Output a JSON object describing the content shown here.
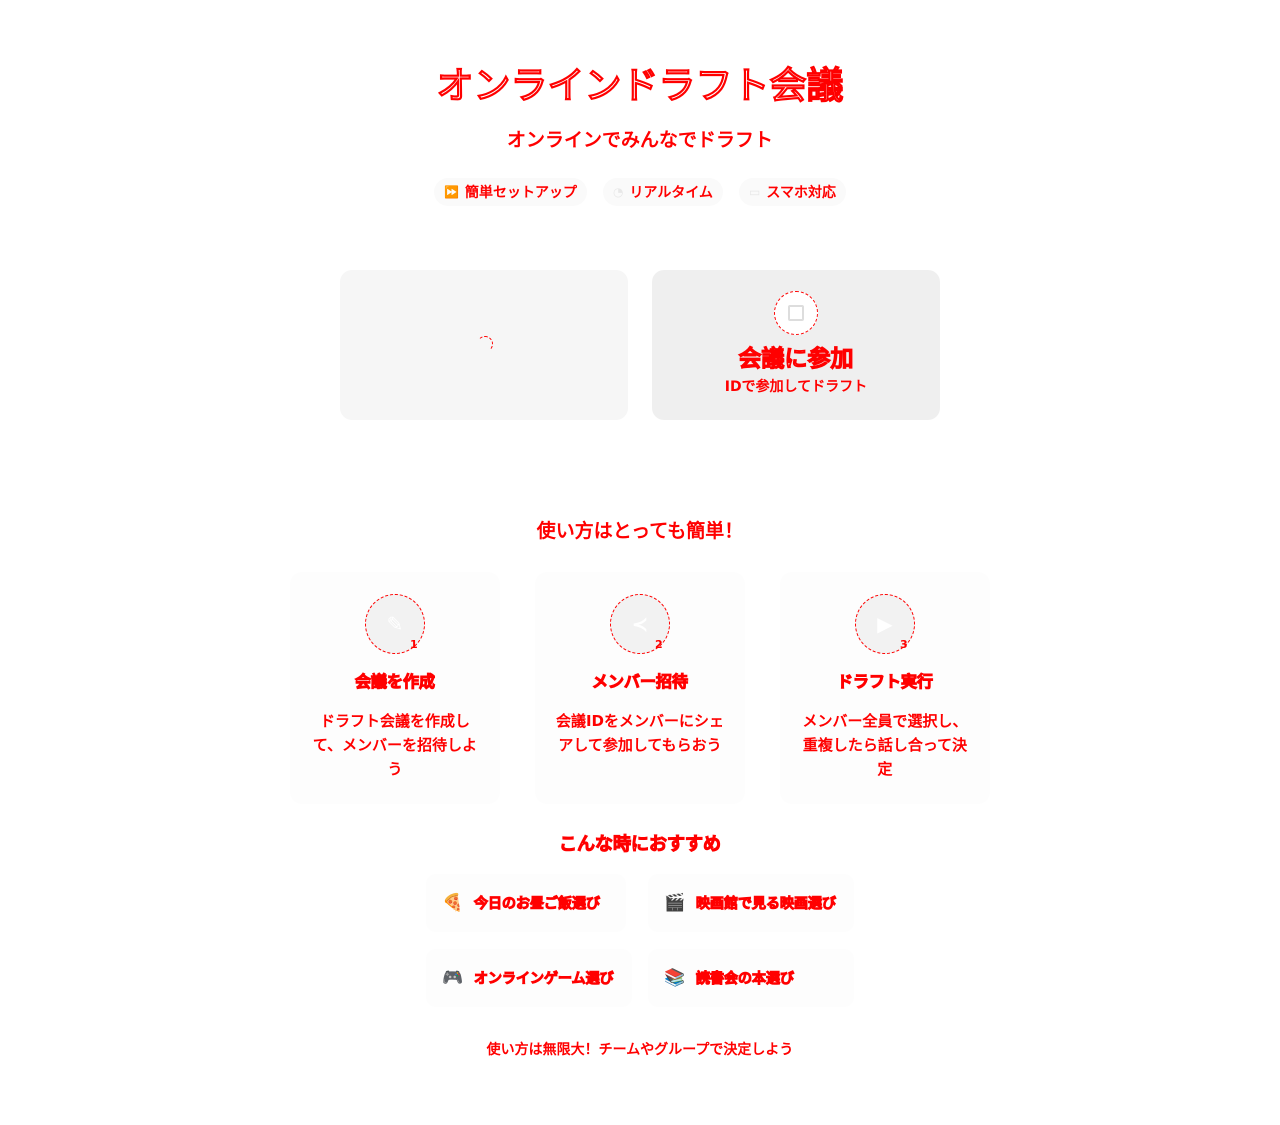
{
  "header": {
    "title": "オンラインドラフト会議",
    "subtitle": "オンラインでみんなでドラフト"
  },
  "features": [
    {
      "icon": "fast-forward-icon",
      "label": "簡単セットアップ"
    },
    {
      "icon": "speedometer-icon",
      "label": "リアルタイム"
    },
    {
      "icon": "device-icon",
      "label": "スマホ対応"
    }
  ],
  "join_card": {
    "icon": "login-icon",
    "title": "会議に参加",
    "subtitle": "IDで参加してドラフト"
  },
  "steps_section": {
    "heading": "使い方はとっても簡単！",
    "steps": [
      {
        "icon": "edit-icon",
        "number": "1",
        "title": "会議を作成",
        "desc": "ドラフト会議を作成して、メンバーを招待しよう"
      },
      {
        "icon": "share-icon",
        "number": "2",
        "title": "メンバー招待",
        "desc": "会議IDをメンバーにシェアして参加してもらおう"
      },
      {
        "icon": "play-icon",
        "number": "3",
        "title": "ドラフト実行",
        "desc": "メンバー全員で選択し、重複したら話し合って決定"
      }
    ]
  },
  "uses_section": {
    "heading": "こんな時におすすめ",
    "items": [
      {
        "icon": "pizza-icon",
        "glyph": "🍕",
        "label": "今日のお昼ご飯選び"
      },
      {
        "icon": "clapperboard-icon",
        "glyph": "🎬",
        "label": "映画館で見る映画選び"
      },
      {
        "icon": "gamepad-icon",
        "glyph": "🎮",
        "label": "オンラインゲーム選び"
      },
      {
        "icon": "books-icon",
        "glyph": "📚",
        "label": "読書会の本選び"
      }
    ]
  },
  "footer": {
    "text": "使い方は無限大！チームやグループで決定しよう"
  },
  "colors": {
    "accent": "#ff0000",
    "card_bg": "#f6f6f6",
    "join_bg": "#efefef"
  }
}
